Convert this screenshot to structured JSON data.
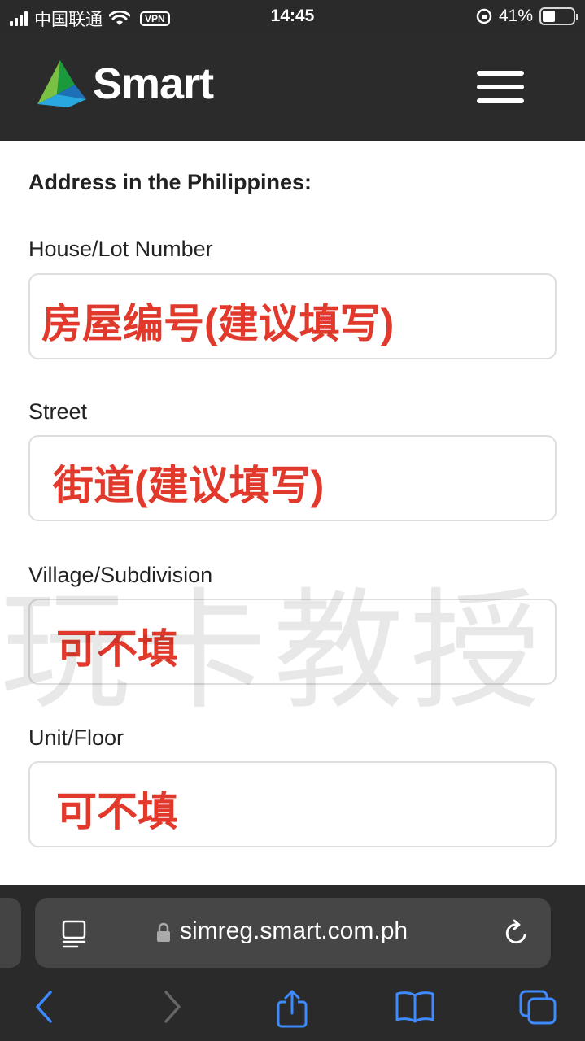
{
  "status_bar": {
    "carrier": "中国联通",
    "vpn": "VPN",
    "time": "14:45",
    "battery": "41%",
    "battery_level": 0.41
  },
  "header": {
    "logo_text": "Smart",
    "menu_icon": "hamburger-menu-icon"
  },
  "form": {
    "section_title": "Address in the Philippines:",
    "fields": [
      {
        "label": "House/Lot Number",
        "value": "房屋编号(建议填写)"
      },
      {
        "label": "Street",
        "value": "街道(建议填写)"
      },
      {
        "label": "Village/Subdivision",
        "value": "可不填"
      },
      {
        "label": "Unit/Floor",
        "value": "可不填"
      }
    ],
    "watermark": "玩卡教授"
  },
  "browser": {
    "url": "simreg.smart.com.ph",
    "icons": [
      "page-menu-icon",
      "lock-icon",
      "reload-icon",
      "back-icon",
      "forward-icon",
      "share-icon",
      "bookmarks-icon",
      "tabs-icon"
    ]
  },
  "colors": {
    "accent_red": "#e13a2c",
    "ios_blue": "#3d8bff",
    "header_bg": "#2b2b2b"
  }
}
